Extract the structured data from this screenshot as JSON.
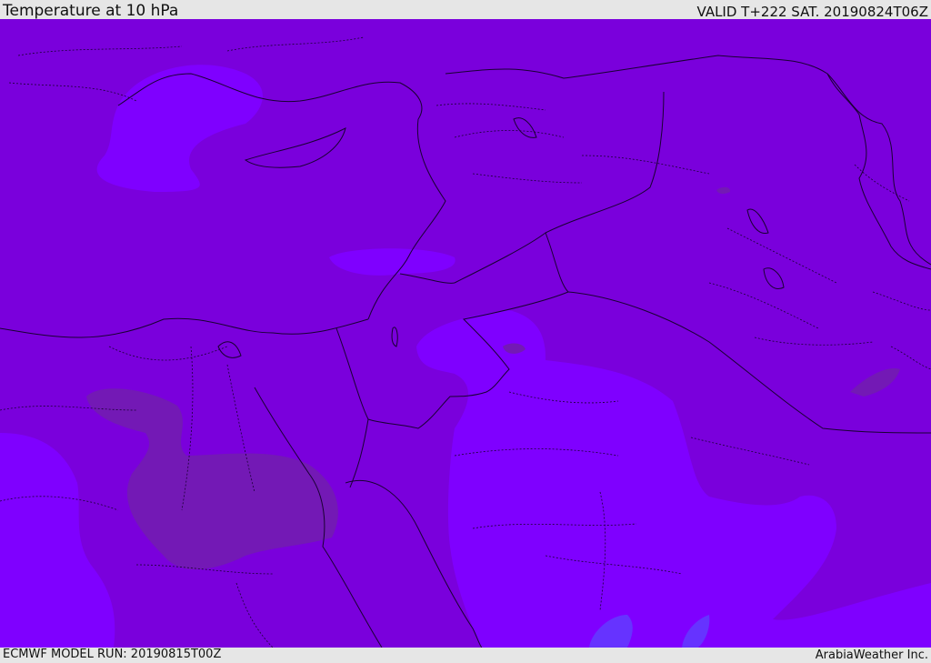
{
  "header": {
    "title": "Temperature at 10 hPa",
    "valid": "VALID T+222 SAT. 20190824T06Z"
  },
  "footer": {
    "model_run": "ECMWF MODEL RUN: 20190815T00Z",
    "credit": "ArabiaWeather Inc."
  },
  "map": {
    "colors": {
      "base": "#7a00dc",
      "warm_patch": "#7f00ff",
      "warmer_patch": "#6633ff",
      "cold_patch": "#7319b5",
      "border": "#1a0033"
    }
  }
}
